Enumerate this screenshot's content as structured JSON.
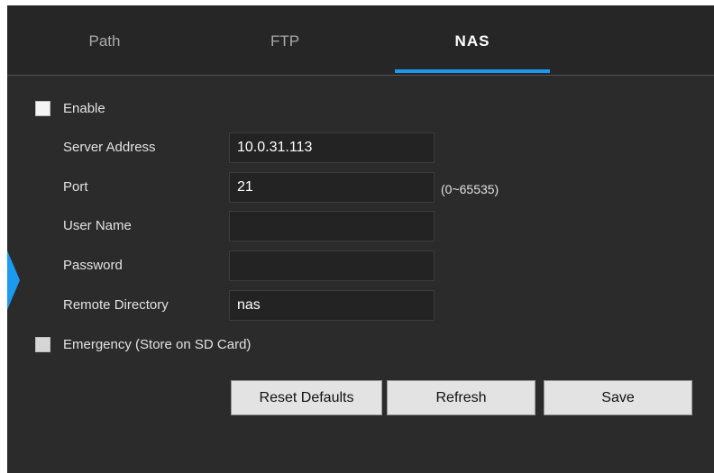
{
  "tabs": [
    {
      "label": "Path",
      "active": false
    },
    {
      "label": "FTP",
      "active": false
    },
    {
      "label": "NAS",
      "active": true
    }
  ],
  "colors": {
    "accent": "#1b9af0",
    "panel_bg": "#2b2b2b",
    "field_bg": "#232323"
  },
  "form": {
    "enable_label": "Enable",
    "enable_checked": false,
    "server_address": {
      "label": "Server Address",
      "value": "10.0.31.113"
    },
    "port": {
      "label": "Port",
      "value": "21",
      "hint": "(0~65535)"
    },
    "user_name": {
      "label": "User Name",
      "value": ""
    },
    "password": {
      "label": "Password",
      "value": ""
    },
    "remote_directory": {
      "label": "Remote Directory",
      "value": "nas"
    },
    "emergency_label": "Emergency (Store on SD Card)",
    "emergency_checked": false
  },
  "buttons": {
    "reset_label": "Reset Defaults",
    "refresh_label": "Refresh",
    "save_label": "Save"
  },
  "icons": {
    "side_toggle": "chevron-right-icon"
  }
}
